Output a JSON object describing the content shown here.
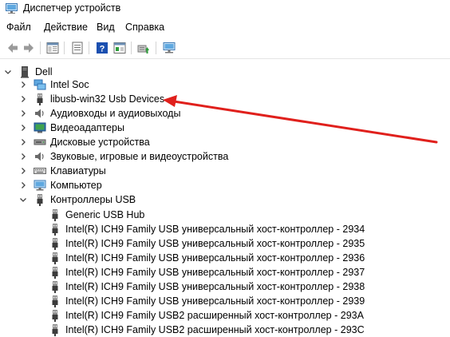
{
  "window": {
    "title": "Диспетчер устройств"
  },
  "menu": {
    "items": [
      "Файл",
      "Действие",
      "Вид",
      "Справка"
    ]
  },
  "tree": {
    "root": "Dell",
    "categories": [
      {
        "label": "Intel Soc",
        "icon": "network-icon",
        "expanded": false
      },
      {
        "label": "libusb-win32 Usb Devices",
        "icon": "usb-plug-icon",
        "expanded": false
      },
      {
        "label": "Аудиовходы и аудиовыходы",
        "icon": "speaker-icon",
        "expanded": false
      },
      {
        "label": "Видеоадаптеры",
        "icon": "display-adapter-icon",
        "expanded": false
      },
      {
        "label": "Дисковые устройства",
        "icon": "disk-drive-icon",
        "expanded": false
      },
      {
        "label": "Звуковые, игровые и видеоустройства",
        "icon": "speaker-icon",
        "expanded": false
      },
      {
        "label": "Клавиатуры",
        "icon": "keyboard-icon",
        "expanded": false
      },
      {
        "label": "Компьютер",
        "icon": "computer-icon",
        "expanded": false
      },
      {
        "label": "Контроллеры USB",
        "icon": "usb-plug-icon",
        "expanded": true
      }
    ],
    "usb_children": [
      "Generic USB Hub",
      "Intel(R) ICH9 Family USB универсальный хост-контроллер  - 2934",
      "Intel(R) ICH9 Family USB универсальный хост-контроллер  - 2935",
      "Intel(R) ICH9 Family USB универсальный хост-контроллер  - 2936",
      "Intel(R) ICH9 Family USB универсальный хост-контроллер  - 2937",
      "Intel(R) ICH9 Family USB универсальный хост-контроллер  - 2938",
      "Intel(R) ICH9 Family USB универсальный хост-контроллер  - 2939",
      "Intel(R) ICH9 Family USB2 расширенный хост-контроллер  - 293A",
      "Intel(R) ICH9 Family USB2 расширенный хост-контроллер  - 293C"
    ]
  },
  "colors": {
    "annotation_arrow": "#e0201c",
    "toolbar_help": "#1a4fb0"
  }
}
